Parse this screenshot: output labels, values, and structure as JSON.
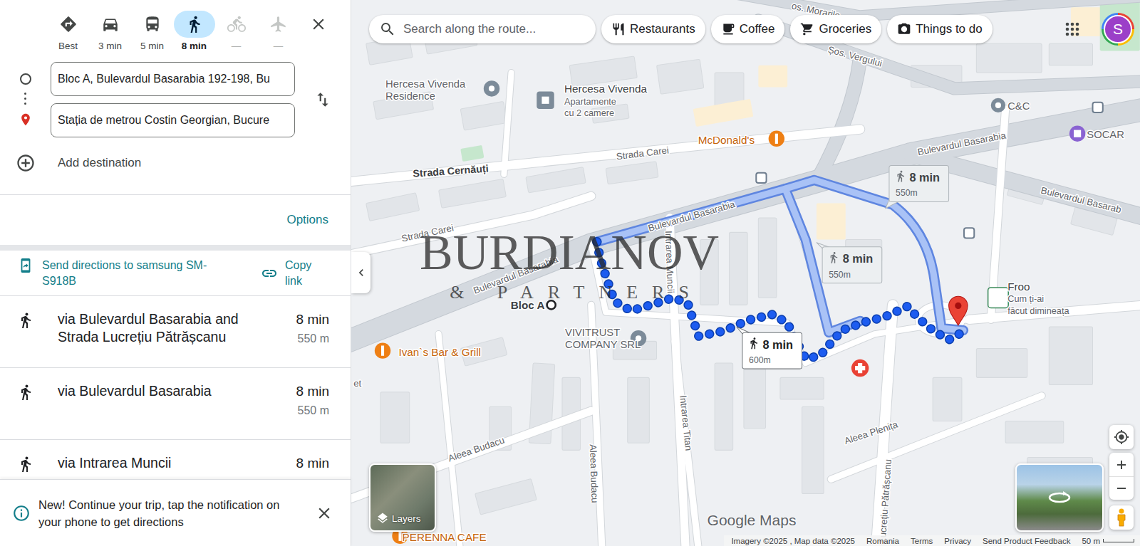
{
  "modes": [
    {
      "kind": "best",
      "label": "Best",
      "selected": false,
      "disabled": false
    },
    {
      "kind": "car",
      "label": "3 min",
      "selected": false,
      "disabled": false
    },
    {
      "kind": "transit",
      "label": "5 min",
      "selected": false,
      "disabled": false
    },
    {
      "kind": "walk",
      "label": "8 min",
      "selected": true,
      "disabled": false
    },
    {
      "kind": "bike",
      "label": "—",
      "selected": false,
      "disabled": true
    },
    {
      "kind": "flight",
      "label": "—",
      "selected": false,
      "disabled": true
    }
  ],
  "origin": "Bloc A, Bulevardul Basarabia 192-198, Bu",
  "destination": "Stația de metrou Costin Georgian, Bucure",
  "add_destination": "Add destination",
  "options": "Options",
  "send_directions": "Send directions to samsung SM-S918B",
  "copy_link": "Copy link",
  "routes": [
    {
      "via": "via Bulevardul Basarabia and Strada Lucrețiu Pătrășcanu",
      "time": "8 min",
      "distance": "550 m"
    },
    {
      "via": "via Bulevardul Basarabia",
      "time": "8 min",
      "distance": "550 m"
    },
    {
      "via": "via Intrarea Muncii",
      "time": "8 min"
    }
  ],
  "notice": "New! Continue your trip, tap the notification on your phone to get directions",
  "map": {
    "search_placeholder": "Search along the route...",
    "chips": [
      {
        "label": "Restaurants",
        "kind": "restaurant"
      },
      {
        "label": "Coffee",
        "kind": "coffee"
      },
      {
        "label": "Groceries",
        "kind": "groceries"
      },
      {
        "label": "Things to do",
        "kind": "things"
      }
    ],
    "avatar": "S",
    "labels": [
      {
        "lines": [
          "os. Morarile"
        ],
        "kind": "street"
      },
      {
        "lines": [
          "Hercesa Vivenda",
          "Residence"
        ],
        "kind": "place"
      },
      {
        "lines": [
          "Hercesa Vivenda"
        ],
        "kind": "place-dark"
      },
      {
        "lines": [
          "Apartamente",
          "cu 2 camere"
        ],
        "kind": "small"
      },
      {
        "lines": [
          "Șos. Vergului"
        ],
        "kind": "street"
      },
      {
        "lines": [
          "C&C"
        ],
        "kind": "place"
      },
      {
        "lines": [
          "SOCAR"
        ],
        "kind": "place"
      },
      {
        "lines": [
          "McDonald's"
        ],
        "kind": "food"
      },
      {
        "lines": [
          "Strada Carei"
        ],
        "kind": "street"
      },
      {
        "lines": [
          "Strada Cernăuți"
        ],
        "kind": "street-dark"
      },
      {
        "lines": [
          "Strada Carei"
        ],
        "kind": "street"
      },
      {
        "lines": [
          "Bulevardul Basarabia"
        ],
        "kind": "street"
      },
      {
        "lines": [
          "Bulevardul Basarabia"
        ],
        "kind": "street"
      },
      {
        "lines": [
          "Bulevardul Basarabia"
        ],
        "kind": "street"
      },
      {
        "lines": [
          "Bulevardul Basarab"
        ],
        "kind": "street"
      },
      {
        "lines": [
          "Intrarea Muncii"
        ],
        "kind": "street"
      },
      {
        "lines": [
          "VIVITRUST",
          "COMPANY SRL"
        ],
        "kind": "place"
      },
      {
        "lines": [
          "Ivan`s Bar & Grill"
        ],
        "kind": "food"
      },
      {
        "lines": [
          "Froo"
        ],
        "kind": "place-dark"
      },
      {
        "lines": [
          "Cum ți-ai",
          "făcut dimineața"
        ],
        "kind": "small"
      },
      {
        "lines": [
          "Aleea Budacu"
        ],
        "kind": "street"
      },
      {
        "lines": [
          "Aleea Budacu"
        ],
        "kind": "street"
      },
      {
        "lines": [
          "Intrarea Titan"
        ],
        "kind": "street"
      },
      {
        "lines": [
          "Aleea Plenița"
        ],
        "kind": "street"
      },
      {
        "lines": [
          "Lucrețiu Pătrășcanu"
        ],
        "kind": "street"
      },
      {
        "lines": [
          "PERENNA CAFE"
        ],
        "kind": "food"
      },
      {
        "lines": [
          "et"
        ],
        "kind": "street"
      }
    ],
    "origin_label": "Bloc A",
    "callouts": [
      {
        "time": "8 min",
        "distance": "550m",
        "selected": false
      },
      {
        "time": "8 min",
        "distance": "550m",
        "selected": false
      },
      {
        "time": "8 min",
        "distance": "600m",
        "selected": true
      }
    ],
    "watermark": {
      "title": "BURDIANOV",
      "subtitle": "& PARTNERS"
    },
    "layers": "Layers",
    "brand": "Google Maps",
    "footer": [
      "Imagery ©2025 , Map data ©2025",
      "Romania",
      "Terms",
      "Privacy",
      "Send Product Feedback"
    ],
    "scale": "50 m"
  }
}
